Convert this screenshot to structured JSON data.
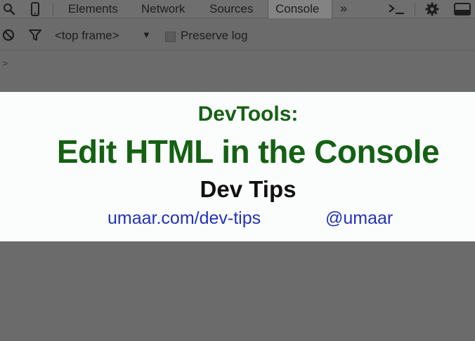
{
  "tabs": {
    "elements": "Elements",
    "network": "Network",
    "sources": "Sources",
    "console": "Console",
    "more": "»"
  },
  "icons": {
    "search": "search-icon",
    "device": "device-mode-icon",
    "execute": "console-drawer-icon",
    "settings": "gear-icon",
    "dock": "dock-side-icon",
    "clear": "clear-console-icon",
    "filter": "filter-icon"
  },
  "toolbar": {
    "frame": "<top frame>",
    "frame_arrow": "▼",
    "preserve_log": "Preserve log",
    "preserve_checked": false
  },
  "console": {
    "prompt": ">"
  },
  "overlay": {
    "subtitle": "DevTools:",
    "title": "Edit HTML in the Console",
    "series": "Dev Tips",
    "site": "umaar.com/dev-tips",
    "handle": "@umaar"
  },
  "colors": {
    "title_green": "#156114",
    "link_blue": "#2233b8",
    "chrome_gray": "#6b6b6b"
  }
}
